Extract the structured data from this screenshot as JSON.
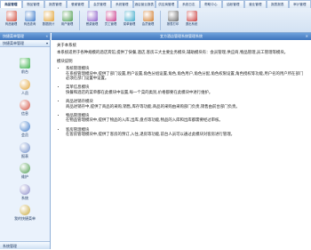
{
  "toolbar": {
    "tabs": [
      "商品管理",
      "物品管理",
      "报表管理",
      "餐桌管理",
      "会员管理",
      "系统管理",
      "酒店营业报表",
      "供应商管理",
      "系统日志",
      "帮助中心",
      "结帐管理",
      "营业管理",
      "报表报表",
      "审计管理"
    ],
    "tools": [
      {
        "label": "商品管理",
        "icon": "goods-icon",
        "color": "#d04a3a"
      },
      {
        "label": "商品查询",
        "icon": "search-goods-icon",
        "color": "#3a78c8"
      },
      {
        "label": "数据统计",
        "icon": "stats-icon",
        "color": "#e0a030"
      },
      {
        "label": "用户管理",
        "icon": "users-icon",
        "color": "#4a9a4a"
      },
      {
        "label": "餐桌管理",
        "icon": "table-icon",
        "color": "#8a5ac8"
      },
      {
        "label": "员工管理",
        "icon": "staff-icon",
        "color": "#c83a8a"
      },
      {
        "label": "菜单管理",
        "icon": "menu-icon",
        "color": "#3aa8c8"
      },
      {
        "label": "会员管理",
        "icon": "member-icon",
        "color": "#d07a2a"
      },
      {
        "label": "报表打印",
        "icon": "print-icon",
        "color": "#6a6a6a"
      },
      {
        "label": "退出系统",
        "icon": "exit-icon",
        "color": "#c83a3a"
      }
    ]
  },
  "sidebar": {
    "title": "快捷菜单管理",
    "subtitle": "快捷菜单管理",
    "items": [
      {
        "label": "前台",
        "icon": "arrow-right-icon",
        "color": "#3ab04a"
      },
      {
        "label": "人员",
        "icon": "people-icon",
        "color": "#e0a030"
      },
      {
        "label": "信息",
        "icon": "info-icon",
        "color": "#d04a3a"
      },
      {
        "label": "会员",
        "icon": "member-card-icon",
        "color": "#3a78c8"
      },
      {
        "label": "报表",
        "icon": "report-icon",
        "color": "#6a8ac8"
      },
      {
        "label": "维护",
        "icon": "wrench-icon",
        "color": "#4a9a4a"
      },
      {
        "label": "系统",
        "icon": "system-icon",
        "color": "#8a8ac8"
      },
      {
        "label": "我的快捷菜单",
        "icon": "shortcut-icon",
        "color": "#c8a83a"
      }
    ],
    "footer": "系统管理"
  },
  "content": {
    "header": "宜方酒店管理系统管理系统",
    "about": "关于本系统",
    "intro": "本系统适用于各种规模的酒店宾馆,提供了快餐,酒店,客房三大主要业务模块,辅助模块有：会员管理,供应商,物品管理,员工管理等模块。",
    "modules_title": "模块说明",
    "modules": [
      {
        "title": "系统管理模块",
        "desc": "在系统管理模块中,提供了部门设置,用户设置,角色分组设置,角色,角色用户,角色分配,角色权限设置,角色授权等功能,用户名的用户所在部门必须在部门设置中设置。"
      },
      {
        "title": "菜单信息模块",
        "desc": "快餐和酒店的菜单都在此模块中设置,每一个菜的类别,价格都要在此模块中进行维护。"
      },
      {
        "title": "商品进销存模块",
        "desc": "商品进销存中,提供了商品的采购,销售,库存等功能,商品的采购由采购部门负责,销售由前台部门负责。"
      },
      {
        "title": "物品管理模块",
        "desc": "在物品管理模块中,提供了物品的入库,出库,盘点等功能,物品的入库和出库都需要经过审核。"
      },
      {
        "title": "客房管理模块",
        "desc": "在客房管理模块中,提供了客房的预订,入住,退房等功能,前台人员可以通过此模块对客房进行管理。"
      }
    ]
  }
}
